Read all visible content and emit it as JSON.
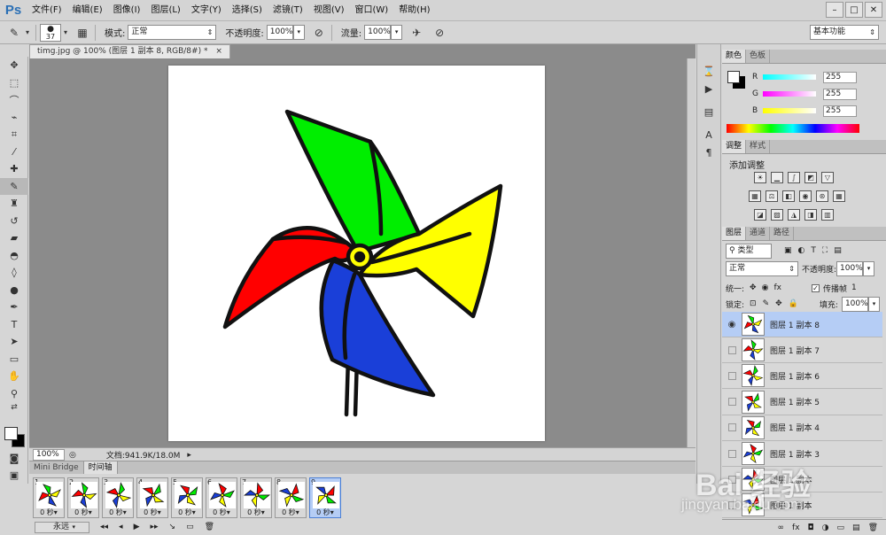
{
  "app": {
    "logo": "Ps"
  },
  "menu": [
    "文件(F)",
    "编辑(E)",
    "图像(I)",
    "图层(L)",
    "文字(Y)",
    "选择(S)",
    "滤镜(T)",
    "视图(V)",
    "窗口(W)",
    "帮助(H)"
  ],
  "window_controls": {
    "minimize": "–",
    "restore": "□",
    "close": "✕"
  },
  "options": {
    "brush_size": "37",
    "mode_label": "模式:",
    "mode_value": "正常",
    "opacity_label": "不透明度:",
    "opacity_value": "100%",
    "flow_label": "流量:",
    "flow_value": "100%",
    "workspace": "基本功能"
  },
  "document": {
    "tab_title": "timg.jpg @ 100% (图层 1 副本 8, RGB/8#) *",
    "tab_close": "×",
    "zoom": "100%",
    "doc_info": "文档:941.9K/18.0M"
  },
  "color_panel": {
    "tabs": [
      "颜色",
      "色板"
    ],
    "r_label": "R",
    "g_label": "G",
    "b_label": "B",
    "r": "255",
    "g": "255",
    "b": "255"
  },
  "adjust_panel": {
    "tabs": [
      "调整",
      "样式"
    ],
    "title": "添加调整"
  },
  "layers_panel": {
    "tabs": [
      "图层",
      "通道",
      "路径"
    ],
    "filter_label": "类型",
    "blend_mode": "正常",
    "opacity_label": "不透明度:",
    "opacity_value": "100%",
    "unify_label": "统一:",
    "propagate_label": "传播帧",
    "propagate_value": "1",
    "lock_label": "锁定:",
    "fill_label": "填充:",
    "fill_value": "100%",
    "layers": [
      {
        "name": "图层 1 副本 8",
        "visible": true,
        "selected": true
      },
      {
        "name": "图层 1 副本 7",
        "visible": false,
        "selected": false
      },
      {
        "name": "图层 1 副本 6",
        "visible": false,
        "selected": false
      },
      {
        "name": "图层 1 副本 5",
        "visible": false,
        "selected": false
      },
      {
        "name": "图层 1 副本 4",
        "visible": false,
        "selected": false
      },
      {
        "name": "图层 1 副本 3",
        "visible": false,
        "selected": false
      },
      {
        "name": "图层 1 副本",
        "visible": false,
        "selected": false
      },
      {
        "name": "图层 1 副本",
        "visible": false,
        "selected": false
      }
    ],
    "bottom_icons": [
      "∞",
      "fx",
      "◘",
      "◑",
      "▭",
      "▤",
      "🗑"
    ]
  },
  "timeline": {
    "tabs": [
      "Mini Bridge",
      "时间轴"
    ],
    "frames": [
      {
        "num": "1",
        "delay": "0 秒▾"
      },
      {
        "num": "2",
        "delay": "0 秒▾"
      },
      {
        "num": "3",
        "delay": "0 秒▾"
      },
      {
        "num": "4",
        "delay": "0 秒▾"
      },
      {
        "num": "5",
        "delay": "0 秒▾"
      },
      {
        "num": "6",
        "delay": "0 秒▾"
      },
      {
        "num": "7",
        "delay": "0 秒▾"
      },
      {
        "num": "8",
        "delay": "0 秒▾"
      },
      {
        "num": "9",
        "delay": "0 秒▾"
      }
    ],
    "loop": "永远",
    "controls": [
      "◂◂",
      "◂",
      "▶",
      "▸▸",
      "↘",
      "▭",
      "🗑"
    ]
  },
  "watermark": {
    "main": "Bai 经验",
    "sub": "jingyan.baidu.com"
  },
  "colors": {
    "pinwheel_green": "#00ee00",
    "pinwheel_yellow": "#ffff00",
    "pinwheel_red": "#ff0000",
    "pinwheel_blue": "#1a3fd8",
    "selection": "#b5cdf5",
    "logo_blue": "#2a6fb5"
  }
}
